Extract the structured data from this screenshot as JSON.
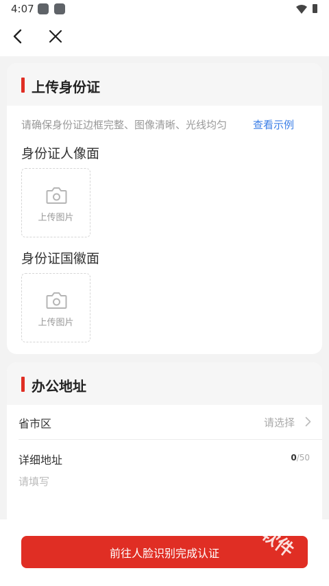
{
  "status_bar": {
    "time": "4:07"
  },
  "id_card": {
    "title": "上传身份证",
    "hint": "请确保身份证边框完整、图像清晰、光线均匀",
    "example_link": "查看示例",
    "portrait_label": "身份证人像面",
    "portrait_upload_label": "上传图片",
    "emblem_label": "身份证国徽面",
    "emblem_upload_label": "上传图片"
  },
  "address": {
    "title": "办公地址",
    "region_label": "省市区",
    "region_placeholder": "请选择",
    "detail_label": "详细地址",
    "detail_count": "0",
    "detail_max": "/50",
    "detail_placeholder": "请填写",
    "detail_value": ""
  },
  "footer": {
    "primary_label": "前往人脸识别完成认证"
  },
  "watermark": "软件",
  "colors": {
    "accent": "#e02e24",
    "link": "#3a7ee6"
  }
}
